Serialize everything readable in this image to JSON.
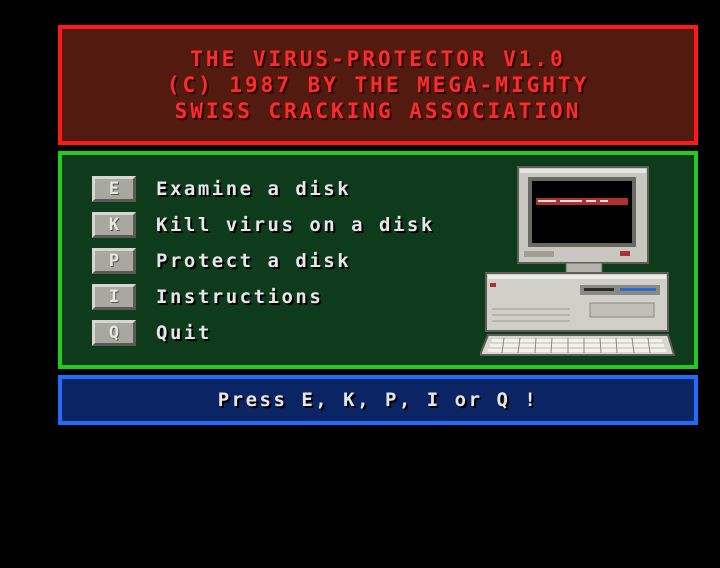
{
  "title": {
    "lines": [
      "THE VIRUS-PROTECTOR V1.0",
      "(C) 1987 BY THE MEGA-MIGHTY",
      "SWISS CRACKING ASSOCIATION"
    ]
  },
  "menu": {
    "items": [
      {
        "key": "E",
        "label": "Examine a disk"
      },
      {
        "key": "K",
        "label": "Kill virus on a disk"
      },
      {
        "key": "P",
        "label": "Protect a disk"
      },
      {
        "key": "I",
        "label": "Instructions"
      },
      {
        "key": "Q",
        "label": "Quit"
      }
    ]
  },
  "prompt": {
    "text": "Press E, K, P, I or Q !"
  },
  "colors": {
    "background": "#000000",
    "title_panel_bg": "#531a10",
    "title_border": "#ff1a1a",
    "title_text": "#ff2a2a",
    "menu_panel_bg": "#0e3b1c",
    "menu_border": "#1fcc1f",
    "prompt_panel_bg": "#0a2464",
    "prompt_border": "#1f6cff",
    "text": "#e6e6e6",
    "key_button": "#a8a8a0"
  },
  "illustration": {
    "icon": "amiga-computer-icon"
  }
}
